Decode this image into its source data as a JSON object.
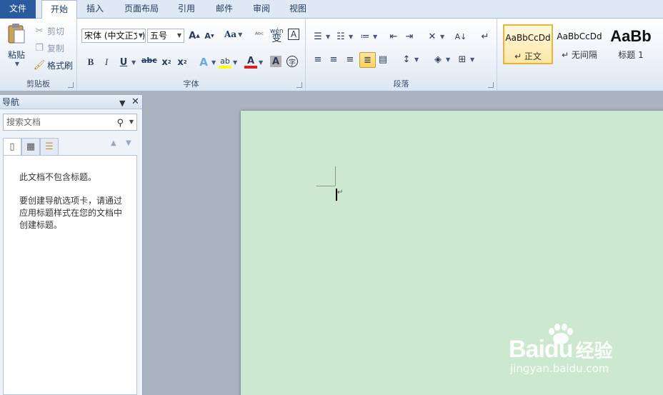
{
  "tabs": {
    "file": "文件",
    "items": [
      "开始",
      "插入",
      "页面布局",
      "引用",
      "邮件",
      "审阅",
      "视图"
    ]
  },
  "clipboard": {
    "paste": "粘贴",
    "cut": "剪切",
    "copy": "复制",
    "format_painter": "格式刷",
    "label": "剪贴板"
  },
  "font": {
    "name": "宋体 (中文正文)",
    "size": "五号",
    "label": "字体",
    "bold": "B",
    "italic": "I",
    "underline": "U",
    "strike": "abc",
    "aa": "Aa",
    "wen": "wén",
    "wen_char": "变"
  },
  "paragraph": {
    "label": "段落"
  },
  "styles": {
    "items": [
      {
        "sample": "AaBbCcDd",
        "name": "↵ 正文"
      },
      {
        "sample": "AaBbCcDd",
        "name": "↵ 无间隔"
      },
      {
        "sample": "AaBb",
        "name": "标题 1"
      }
    ]
  },
  "nav": {
    "title": "导航",
    "search_placeholder": "搜索文档",
    "message1": "此文档不包含标题。",
    "message2": "要创建导航选项卡，请通过应用标题样式在您的文档中创建标题。"
  },
  "watermark": {
    "logo": "Bai",
    "logo2": "du",
    "logo3": "经验",
    "url": "jingyan.baidu.com"
  },
  "colors": {
    "file_tab": "#2a5aa0",
    "page": "#cce8cf",
    "active_style": "#ffd25c"
  }
}
